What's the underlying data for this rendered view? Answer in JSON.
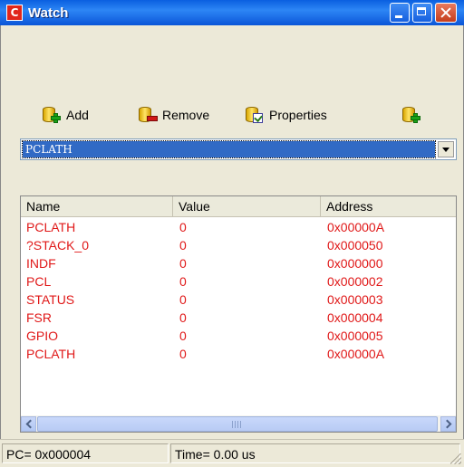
{
  "window": {
    "title": "Watch",
    "app_icon_letter": "C"
  },
  "toolbar": {
    "add_label": "Add",
    "remove_label": "Remove",
    "properties_label": "Properties"
  },
  "combo": {
    "selected": "PCLATH"
  },
  "list": {
    "columns": [
      "Name",
      "Value",
      "Address"
    ],
    "rows": [
      {
        "name": "PCLATH",
        "value": "0",
        "address": "0x00000A"
      },
      {
        "name": "?STACK_0",
        "value": "0",
        "address": "0x000050"
      },
      {
        "name": "INDF",
        "value": "0",
        "address": "0x000000"
      },
      {
        "name": "PCL",
        "value": "0",
        "address": "0x000002"
      },
      {
        "name": "STATUS",
        "value": "0",
        "address": "0x000003"
      },
      {
        "name": "FSR",
        "value": "0",
        "address": "0x000004"
      },
      {
        "name": "GPIO",
        "value": "0",
        "address": "0x000005"
      },
      {
        "name": "PCLATH",
        "value": "0",
        "address": "0x00000A"
      }
    ]
  },
  "statusbar": {
    "pc": "PC= 0x000004",
    "time": "Time= 0.00 us"
  },
  "colors": {
    "row_text": "#e01818",
    "selection": "#316ac5",
    "titlebar": "#0a5fe0"
  },
  "icons": {
    "add": "database-add-icon",
    "remove": "database-remove-icon",
    "properties": "database-properties-icon",
    "extra": "database-add-icon"
  }
}
